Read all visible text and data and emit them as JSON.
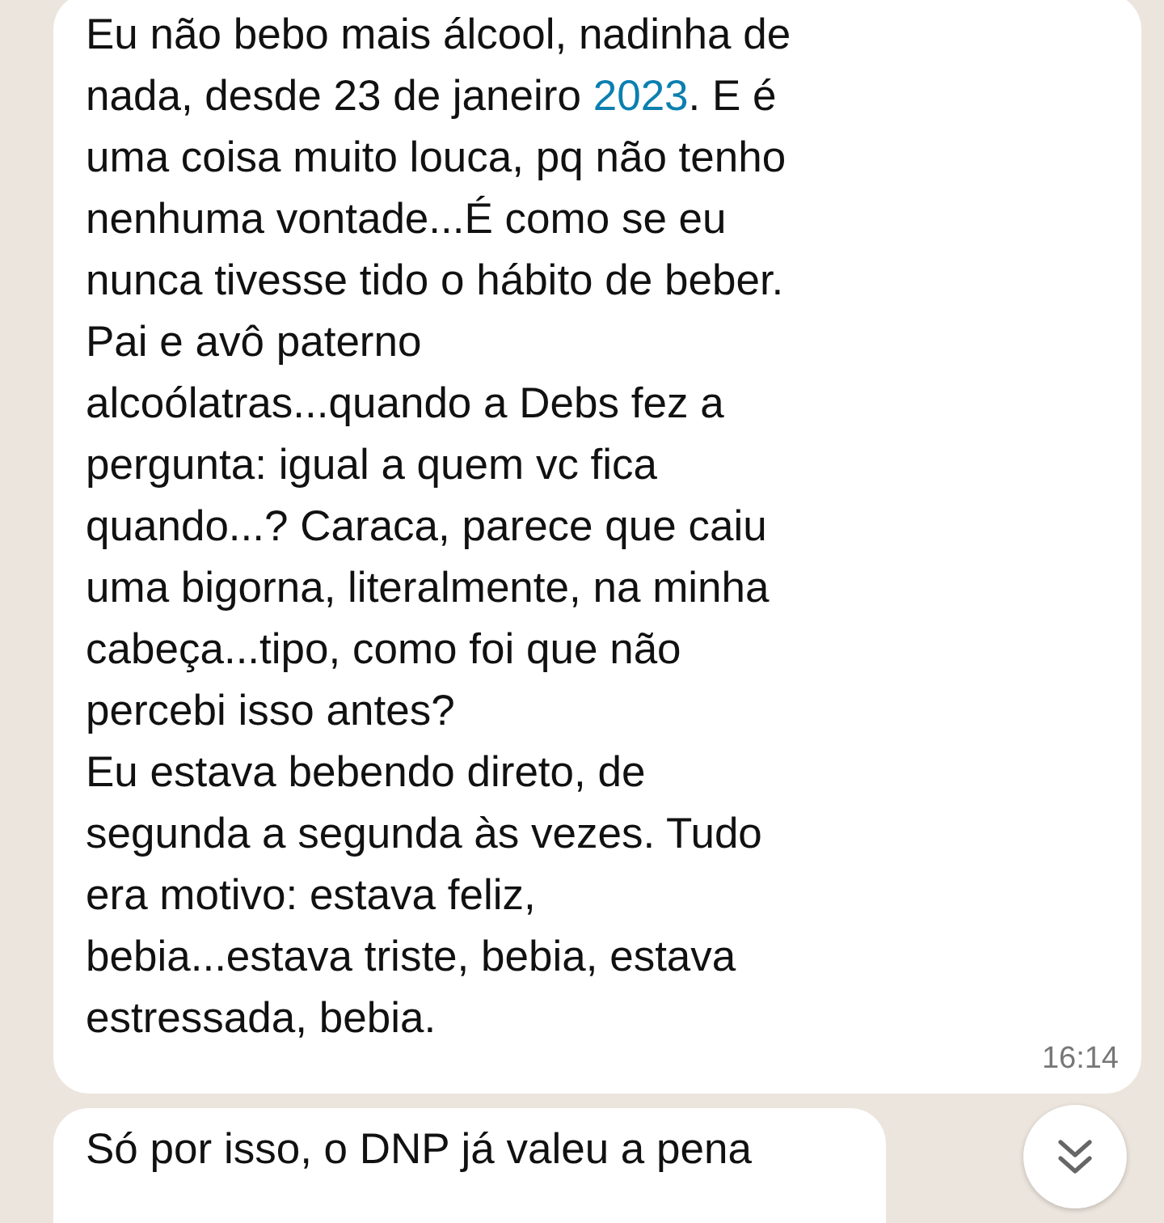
{
  "messages": [
    {
      "lines_before": "Eu não bebo mais álcool, nadinha de\nnada, desde 23 de janeiro ",
      "link": "2023",
      "lines_after": ". E é\numa coisa muito louca, pq não tenho\nnenhuma vontade...É como se eu\nnunca tivesse tido o hábito de beber.\nPai e avô paterno\nalcoólatras...quando a Debs fez a\npergunta: igual a quem vc fica\nquando...? Caraca, parece que caiu\numa bigorna, literalmente, na minha\ncabeça...tipo, como foi que não\npercebi isso antes?\nEu estava bebendo direto, de\nsegunda a segunda às vezes. Tudo\nera motivo: estava feliz,\nbebia...estava triste, bebia, estava\nestressada, bebia.",
      "time": "16:14"
    },
    {
      "lines_before": "Só por isso, o DNP já valeu a pena"
    }
  ]
}
